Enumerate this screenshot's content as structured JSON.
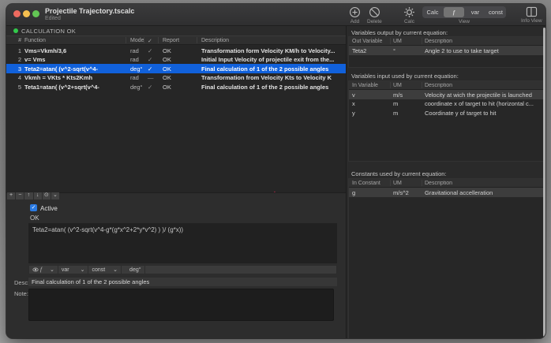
{
  "window": {
    "title": "Projectile Trajectory.tscalc",
    "edited": "Edited"
  },
  "toolbar": {
    "add_label": "Add",
    "delete_label": "Delete",
    "calc_label": "Calc",
    "view_label": "View",
    "info_view_label": "Info View",
    "view_segments": [
      "Calc",
      "f",
      "var",
      "const"
    ],
    "selected_segment": "f"
  },
  "status": {
    "text": "CALCULATION OK"
  },
  "function_table": {
    "headers": {
      "num": "#",
      "function": "Function",
      "mode": "Mode",
      "check": "✓",
      "report": "Report",
      "description": "Description"
    },
    "rows": [
      {
        "num": "1",
        "function": "Vms=Vkmh/3,6",
        "mode": "rad",
        "check": "✓",
        "report": "OK",
        "description": "Transformation form Velocity KM/h to Velocity...",
        "selected": false
      },
      {
        "num": "2",
        "function": "v= Vms",
        "mode": "rad",
        "check": "✓",
        "report": "OK",
        "description": "Initial Input Velocity of projectile exit from the...",
        "selected": false
      },
      {
        "num": "3",
        "function": "Teta2=atan(  (v^2-sqrt(v^4-",
        "mode": "deg°",
        "check": "✓",
        "report": "OK",
        "description": "Final calculation of 1 of the 2 possible angles",
        "selected": true
      },
      {
        "num": "4",
        "function": "Vkmh = VKts * Kts2Kmh",
        "mode": "rad",
        "check": "—",
        "report": "OK",
        "description": "Transformation from Velocity Kts to Velocity K",
        "selected": false
      },
      {
        "num": "5",
        "function": "Teta1=atan(  (v^2+sqrt(v^4-",
        "mode": "deg°",
        "check": "✓",
        "report": "OK",
        "description": "Final calculation of 1 of the 2 possible angles",
        "selected": false
      }
    ]
  },
  "editor": {
    "icons": {
      "add": "+",
      "remove": "−",
      "up": "↑",
      "down": "↓",
      "action": "⊙",
      "chevron": "⌄"
    },
    "active_label": "Active",
    "active_checked": true,
    "result": "OK",
    "formula": "Teta2=atan(  (v^2-sqrt(v^4-g*(g*x^2+2*y*v^2) ) )/ (g*x))",
    "fbar": {
      "f": "f",
      "var": "var",
      "const": "const",
      "deg": "deg°"
    },
    "desc_label": "Desc:",
    "desc_value": "Final calculation of 1 of the 2 possible angles",
    "note_label": "Note:",
    "note_value": ""
  },
  "right_panel": {
    "output": {
      "title": "Variables output by current equation:",
      "headers": {
        "name": "Out Variable",
        "um": "UM",
        "desc": "Description"
      },
      "rows": [
        {
          "name": "Teta2",
          "um": "°",
          "desc": "Angle 2 to use to take target"
        }
      ]
    },
    "input": {
      "title": "Variables input used by current equation:",
      "headers": {
        "name": "In Variable",
        "um": "UM",
        "desc": "Description"
      },
      "rows": [
        {
          "name": "v",
          "um": "m/s",
          "desc": "Velocity at wich the projectile is launched"
        },
        {
          "name": "x",
          "um": "m",
          "desc": "coordinate x of target to hit (horizontal c..."
        },
        {
          "name": "y",
          "um": "m",
          "desc": "Coordinate y of target to hit"
        }
      ]
    },
    "constants": {
      "title": "Constants used by current equation:",
      "headers": {
        "name": "In Constant",
        "um": "UM",
        "desc": "Description"
      },
      "rows": [
        {
          "name": "g",
          "um": "m/s^2",
          "desc": "Gravitational accelleration"
        }
      ]
    }
  },
  "colors": {
    "selection_blue": "#1161db",
    "status_ok_green": "#32c94b",
    "traffic_red": "#ed6a5f",
    "traffic_yellow": "#f5bf4f",
    "traffic_green": "#62c554",
    "checkbox_blue": "#2a7ae2"
  }
}
